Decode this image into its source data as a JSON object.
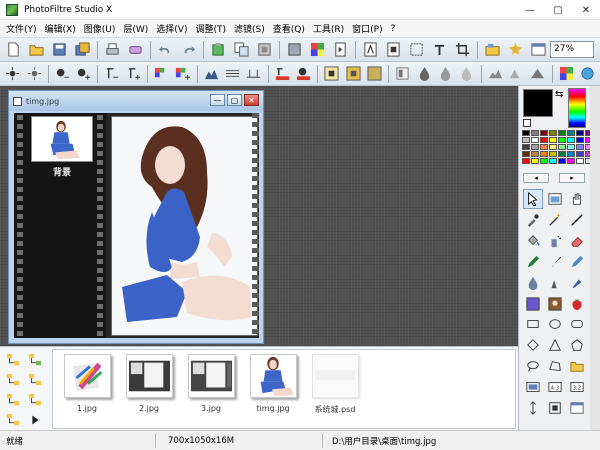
{
  "window": {
    "title": "PhotoFiltre Studio X",
    "controls": [
      "—",
      "▢",
      "✕"
    ]
  },
  "menu": [
    "文件(Y)",
    "编辑(X)",
    "图像(U)",
    "层(W)",
    "选择(V)",
    "调整(T)",
    "滤镜(S)",
    "查看(Q)",
    "工具(R)",
    "窗口(P)",
    "?"
  ],
  "toolbar": {
    "zoom": "27%"
  },
  "document": {
    "title": "timg.jpg",
    "layer_label": "背景"
  },
  "explorer": {
    "files": [
      "1.jpg",
      "2.jpg",
      "3.jpg",
      "timg.jpg",
      "系统城.psd"
    ]
  },
  "status": {
    "state": "就绪",
    "size": "700x1050x16M",
    "path": "D:\\用户目录\\桌面\\timg.jpg"
  },
  "colors": {
    "foreground": "#000000",
    "background": "#ffffff",
    "palette": [
      "#000000",
      "#808080",
      "#800000",
      "#808000",
      "#008000",
      "#008080",
      "#000080",
      "#800080",
      "#c0c0c0",
      "#ffffff",
      "#ff0000",
      "#ffff00",
      "#00ff00",
      "#00ffff",
      "#0000ff",
      "#ff00ff",
      "#404040",
      "#a0a0a0",
      "#ff8040",
      "#ffff80",
      "#80ff80",
      "#80ffff",
      "#8080ff",
      "#ff80ff",
      "#603000",
      "#c08040",
      "#ff8000",
      "#c0c000",
      "#008040",
      "#0080c0",
      "#4040c0",
      "#c040c0",
      "#ff0000",
      "#ffff00",
      "#00ff00",
      "#00ffff",
      "#0000ff",
      "#ff00ff",
      "#ffffff",
      "#e0e0e0"
    ]
  }
}
